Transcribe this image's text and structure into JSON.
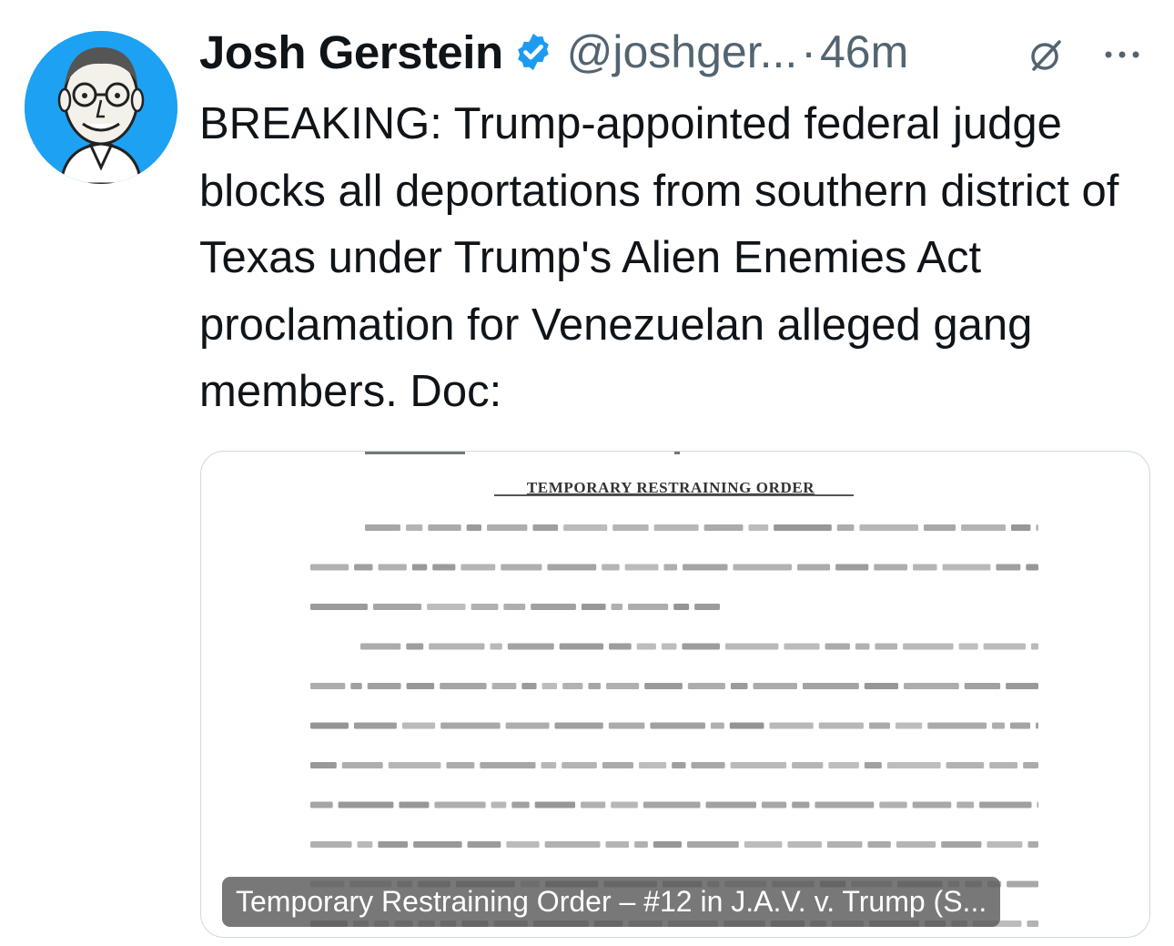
{
  "author": {
    "name": "Josh Gerstein",
    "handle": "@joshger...",
    "separator": "·",
    "time": "46m"
  },
  "icons": {
    "verified": "verified-badge-icon",
    "grok": "grok-icon",
    "more": "more-options-icon"
  },
  "colors": {
    "verified_blue": "#1d9bf0",
    "avatar_bg": "#1da1f2",
    "secondary_text": "#536471"
  },
  "tweet": {
    "text": "BREAKING: Trump-appointed federal judge blocks all deportations from southern district of Texas under Trump's Alien Enemies Act proclamation for Venezuelan alleged gang members. Doc:"
  },
  "card": {
    "doc_title": "TEMPORARY RESTRAINING ORDER",
    "caption": "Temporary Restraining Order – #12 in J.A.V. v. Trump (S..."
  }
}
